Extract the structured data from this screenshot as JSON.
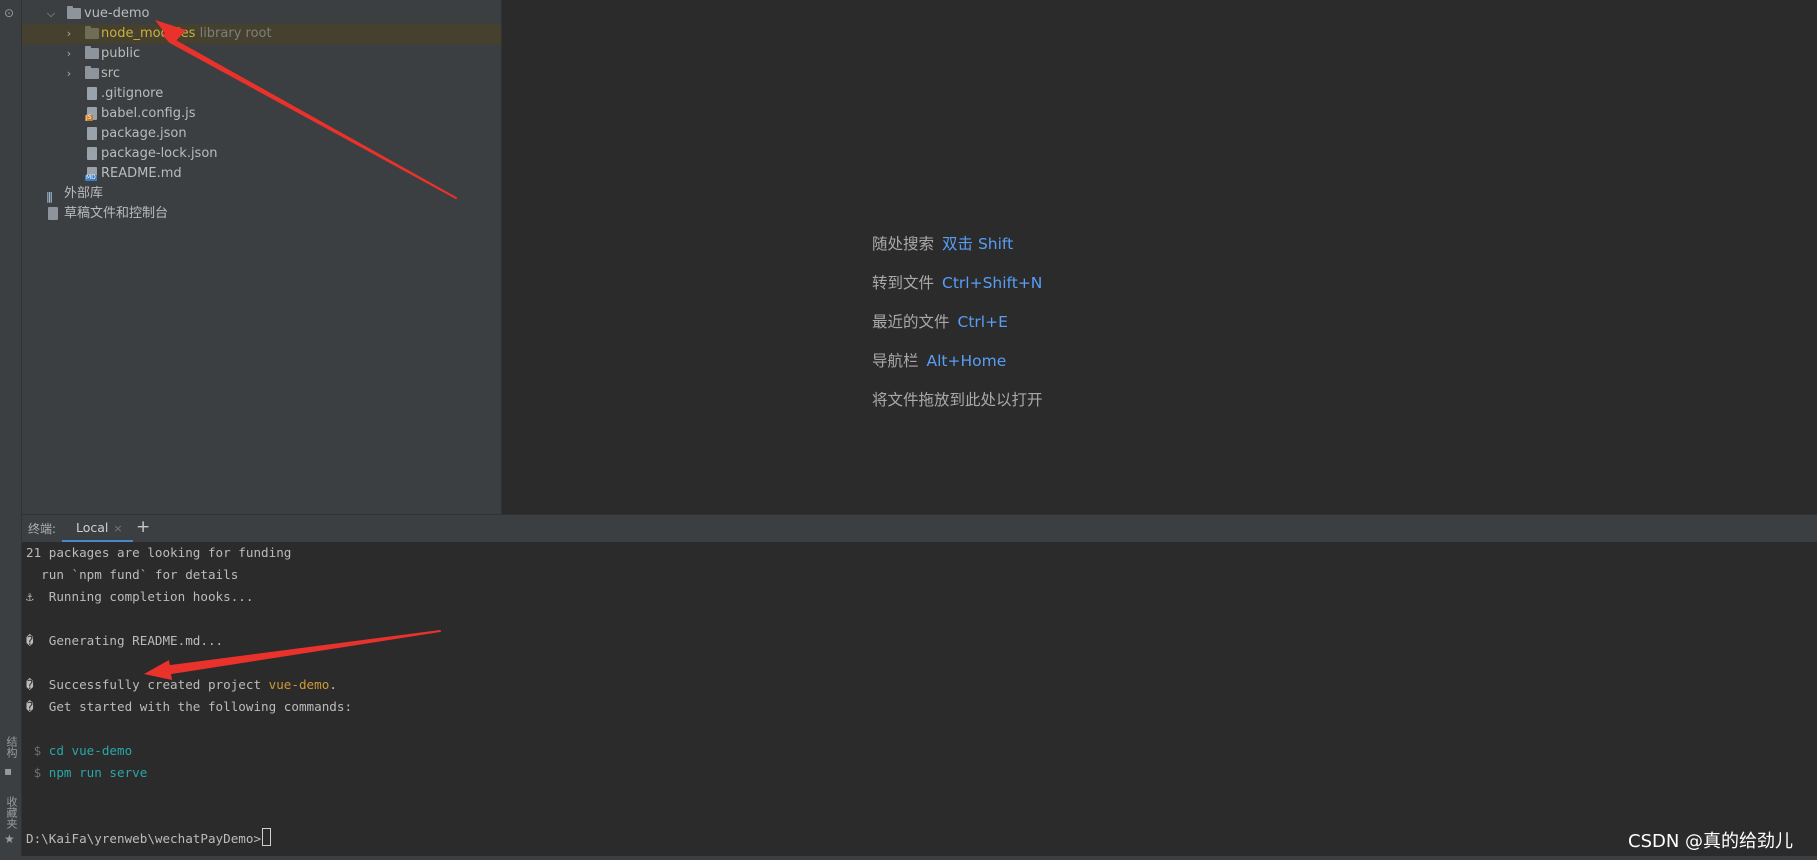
{
  "sidebar": {
    "structure_label": "结构",
    "favorites_label": "收藏夹"
  },
  "project": {
    "items": [
      {
        "label": "vue-demo",
        "kind": "folder",
        "expanded": true
      },
      {
        "label": "node_modules",
        "hint": "library root",
        "kind": "folder",
        "expanded": false
      },
      {
        "label": "public",
        "kind": "folder",
        "expanded": false
      },
      {
        "label": "src",
        "kind": "folder",
        "expanded": false
      },
      {
        "label": ".gitignore",
        "kind": "file"
      },
      {
        "label": "babel.config.js",
        "kind": "file",
        "badge": "JS"
      },
      {
        "label": "package.json",
        "kind": "file"
      },
      {
        "label": "package-lock.json",
        "kind": "file"
      },
      {
        "label": "README.md",
        "kind": "file",
        "badge": "MD"
      },
      {
        "label": "外部库",
        "kind": "library"
      },
      {
        "label": "草稿文件和控制台",
        "kind": "scratch"
      }
    ]
  },
  "editor": {
    "hints": [
      {
        "label": "随处搜索",
        "key": "双击 Shift"
      },
      {
        "label": "转到文件",
        "key": "Ctrl+Shift+N"
      },
      {
        "label": "最近的文件",
        "key": "Ctrl+E"
      },
      {
        "label": "导航栏",
        "key": "Alt+Home"
      },
      {
        "label": "将文件拖放到此处以打开",
        "key": ""
      }
    ]
  },
  "terminal": {
    "title": "终端:",
    "tab_label": "Local",
    "tab_close": "×",
    "add_label": "+",
    "lines": {
      "l1": "21 packages are looking for funding",
      "l2": "  run `npm fund` for details",
      "l3": "⚓  Running completion hooks...",
      "l4": "�  Generating README.md...",
      "l5a": "�  Successfully created project ",
      "l5b": "vue-demo",
      "l5c": ".",
      "l6": "�  Get started with the following commands:",
      "l7_prompt": " $ ",
      "l7_cmd": "cd vue-demo",
      "l8_prompt": " $ ",
      "l8_cmd": "npm run serve",
      "prompt": "D:\\KaiFa\\yrenweb\\wechatPayDemo>"
    }
  },
  "watermark": "CSDN @真的给劲儿",
  "colors": {
    "accent_blue": "#589df6",
    "annotation_red": "#e8322b",
    "project_name_orange": "#cc9933",
    "command_cyan": "#29a7a7"
  }
}
